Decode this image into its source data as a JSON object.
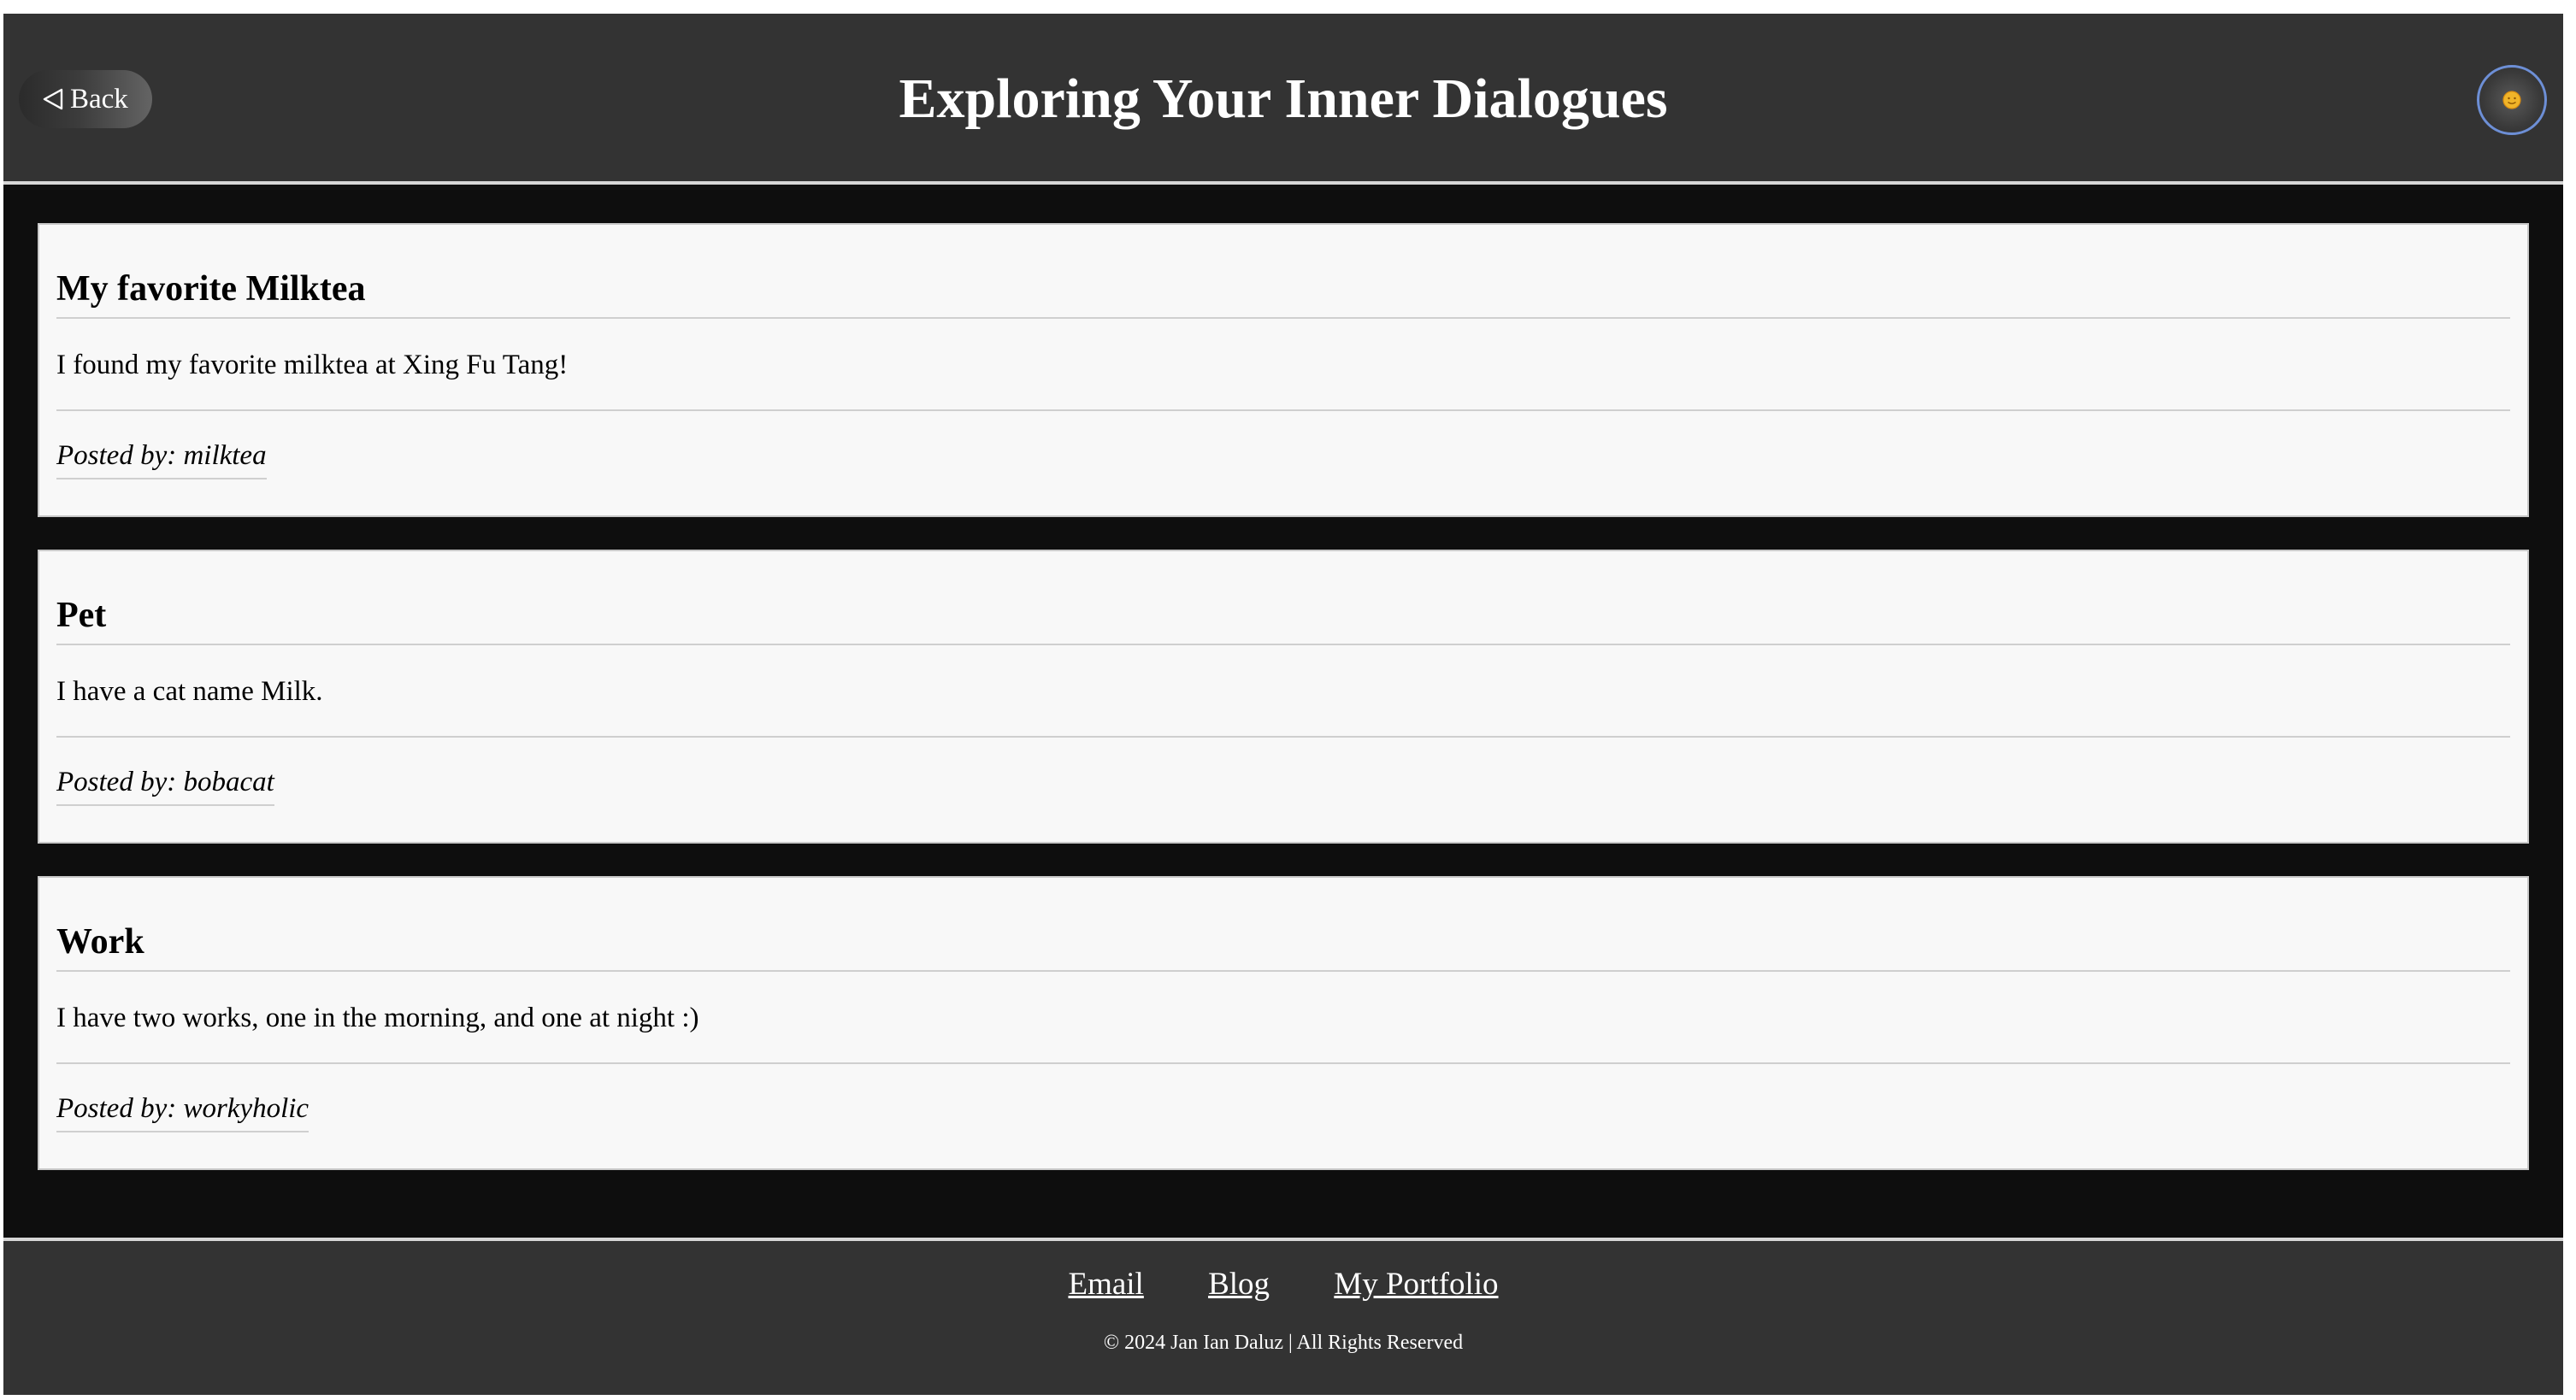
{
  "header": {
    "back_label": "Back",
    "title": "Exploring Your Inner Dialogues",
    "theme_toggle_icon": "sun-icon"
  },
  "posts": [
    {
      "title": "My favorite Milktea",
      "body": "I found my favorite milktea at Xing Fu Tang!",
      "posted_by": "Posted by: milktea"
    },
    {
      "title": "Pet",
      "body": "I have a cat name Milk.",
      "posted_by": "Posted by: bobacat"
    },
    {
      "title": "Work",
      "body": "I have two works, one in the morning, and one at night :)",
      "posted_by": "Posted by: workyholic"
    }
  ],
  "footer": {
    "links": [
      "Email",
      "Blog",
      "My Portfolio"
    ],
    "copyright": "© 2024 Jan Ian Daluz | All Rights Reserved"
  },
  "colors": {
    "header_bg": "#333333",
    "page_bg": "#0e0e0e",
    "card_bg": "#f8f8f8",
    "toggle_ring": "#6d8fd6",
    "sun": "#f0b429"
  }
}
